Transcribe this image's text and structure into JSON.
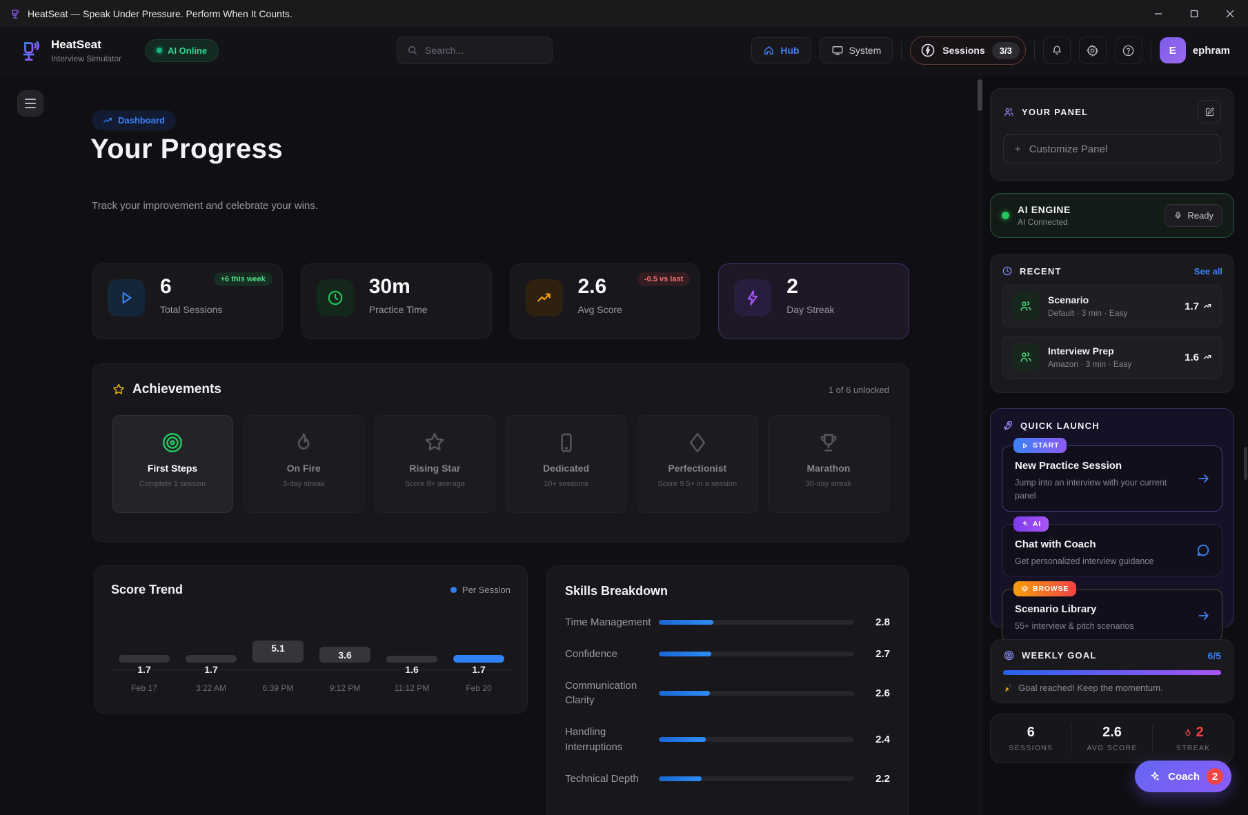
{
  "titlebar": {
    "title": "HeatSeat — Speak Under Pressure. Perform When It Counts."
  },
  "header": {
    "app_name": "HeatSeat",
    "app_subtitle": "Interview Simulator",
    "ai_status": "AI Online",
    "search_placeholder": "Search...",
    "hub_label": "Hub",
    "system_label": "System",
    "sessions_label": "Sessions",
    "sessions_count": "3/3",
    "avatar_initial": "E",
    "username": "ephram"
  },
  "page": {
    "breadcrumb": "Dashboard",
    "title": "Your Progress",
    "subtitle": "Track your improvement and celebrate your wins."
  },
  "stats": [
    {
      "value": "6",
      "label": "Total Sessions",
      "badge": "+6 this week"
    },
    {
      "value": "30m",
      "label": "Practice Time"
    },
    {
      "value": "2.6",
      "label": "Avg Score",
      "badge": "-0.5 vs last"
    },
    {
      "value": "2",
      "label": "Day Streak"
    }
  ],
  "achievements": {
    "title": "Achievements",
    "unlocked_text": "1 of 6 unlocked",
    "items": [
      {
        "icon": "bullseye-icon",
        "name": "First Steps",
        "desc": "Complete 1 session"
      },
      {
        "icon": "flame-icon",
        "name": "On Fire",
        "desc": "3-day streak"
      },
      {
        "icon": "star-icon",
        "name": "Rising Star",
        "desc": "Score 8+ average"
      },
      {
        "icon": "phone-icon",
        "name": "Dedicated",
        "desc": "10+ sessions"
      },
      {
        "icon": "diamond-icon",
        "name": "Perfectionist",
        "desc": "Score 9.5+ in a session"
      },
      {
        "icon": "trophy-icon",
        "name": "Marathon",
        "desc": "30-day streak"
      }
    ]
  },
  "chart_data": [
    {
      "type": "bar",
      "title": "Score Trend",
      "legend": "Per Session",
      "x": [
        "Feb 17",
        "3:22 AM",
        "6:39 PM",
        "9:12 PM",
        "11:12 PM",
        "Feb 20"
      ],
      "values": [
        1.7,
        1.7,
        5.1,
        3.6,
        1.6,
        1.7
      ],
      "highlight_index": 5,
      "ylim": [
        0,
        10
      ],
      "bar_color": "#35353b",
      "highlight_color": "#2f81f7"
    },
    {
      "type": "bar",
      "orientation": "horizontal",
      "title": "Skills Breakdown",
      "categories": [
        "Time Management",
        "Confidence",
        "Communication Clarity",
        "Handling Interruptions",
        "Technical Depth"
      ],
      "values": [
        2.8,
        2.7,
        2.6,
        2.4,
        2.2
      ],
      "xlim": [
        0,
        10
      ],
      "bar_color": "#2f8df5"
    }
  ],
  "sidebar": {
    "your_panel": {
      "title": "YOUR PANEL",
      "customize_label": "Customize Panel",
      "plus": "+"
    },
    "ai_engine": {
      "title": "AI ENGINE",
      "status": "AI Connected",
      "ready_label": "Ready"
    },
    "recent": {
      "title": "RECENT",
      "see_all": "See all",
      "items": [
        {
          "name": "Scenario",
          "meta": "Default · 3 min · Easy",
          "score": "1.7"
        },
        {
          "name": "Interview Prep",
          "meta": "Amazon · 3 min · Easy",
          "score": "1.6"
        }
      ]
    },
    "quick_launch": {
      "title": "QUICK LAUNCH",
      "items": [
        {
          "badge": "START",
          "name": "New Practice Session",
          "desc": "Jump into an interview with your current panel",
          "action": "arrow"
        },
        {
          "badge": "AI",
          "name": "Chat with Coach",
          "desc": "Get personalized interview guidance",
          "action": "chat"
        },
        {
          "badge": "BROWSE",
          "name": "Scenario Library",
          "desc": "55+ interview & pitch scenarios",
          "action": "arrow"
        }
      ]
    },
    "weekly_goal": {
      "title": "WEEKLY GOAL",
      "progress": "6/5",
      "caption": "Goal reached! Keep the momentum."
    },
    "footer_stats": [
      {
        "value": "6",
        "label": "SESSIONS"
      },
      {
        "value": "2.6",
        "label": "AVG SCORE"
      },
      {
        "value": "2",
        "label": "STREAK"
      }
    ],
    "coach": {
      "label": "Coach",
      "badge": "2"
    }
  },
  "colors": {
    "blue": "#3b82f6",
    "green": "#22c55e",
    "orange": "#f59e0b",
    "purple": "#a855f7",
    "red": "#ef4444"
  }
}
